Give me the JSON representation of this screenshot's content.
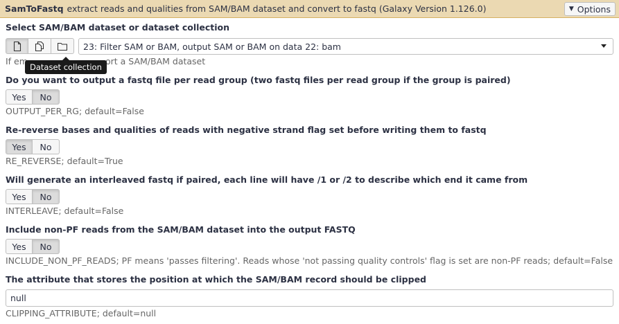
{
  "header": {
    "tool_name": "SamToFastq",
    "tool_description": "extract reads and qualities from SAM/BAM dataset and convert to fastq (Galaxy Version 1.126.0)",
    "options_label": "Options"
  },
  "input_dataset": {
    "label": "Select SAM/BAM dataset or dataset collection",
    "source_icons": [
      "file-icon",
      "files-icon",
      "folder-icon"
    ],
    "selected_value": "23: Filter SAM or BAM, output SAM or BAM on data 22: bam",
    "help_visible_start": "If em",
    "help_visible_end": "ort a SAM/BAM dataset",
    "tooltip": "Dataset collection"
  },
  "params": [
    {
      "label": "Do you want to output a fastq file per read group (two fastq files per read group if the group is paired)",
      "yes": "Yes",
      "no": "No",
      "selected": "No",
      "help": "OUTPUT_PER_RG; default=False"
    },
    {
      "label": "Re-reverse bases and qualities of reads with negative strand flag set before writing them to fastq",
      "yes": "Yes",
      "no": "No",
      "selected": "Yes",
      "help": "RE_REVERSE; default=True"
    },
    {
      "label": "Will generate an interleaved fastq if paired, each line will have /1 or /2 to describe which end it came from",
      "yes": "Yes",
      "no": "No",
      "selected": "No",
      "help": "INTERLEAVE; default=False"
    },
    {
      "label": "Include non-PF reads from the SAM/BAM dataset into the output FASTQ",
      "yes": "Yes",
      "no": "No",
      "selected": "No",
      "help": "INCLUDE_NON_PF_READS; PF means 'passes filtering'. Reads whose 'not passing quality controls' flag is set are non-PF reads; default=False"
    }
  ],
  "clipping": {
    "label": "The attribute that stores the position at which the SAM/BAM record should be clipped",
    "value": "null",
    "help": "CLIPPING_ATTRIBUTE; default=null"
  }
}
